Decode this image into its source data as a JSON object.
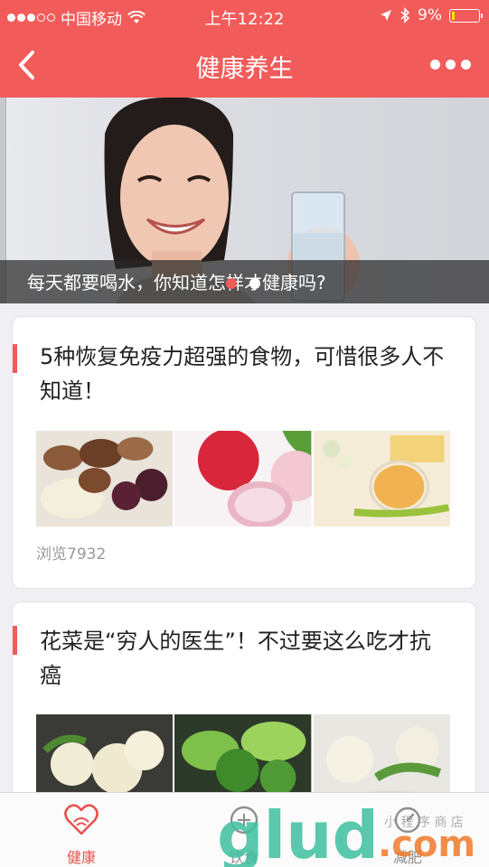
{
  "status_bar": {
    "carrier": "中国移动",
    "time": "上午12:22",
    "battery": "9%",
    "battery_level": 0.09
  },
  "nav": {
    "title": "健康养生"
  },
  "banner": {
    "caption": "每天都要喝水，你知道怎样才健康吗?",
    "active_page": 1,
    "page_count": 2
  },
  "articles": [
    {
      "title": "5种恢复免疫力超强的食物，可惜很多人不知道！",
      "views": "浏览7932"
    },
    {
      "title": "花菜是“穷人的医生”！不过要这么吃才抗癌"
    }
  ],
  "tabs": [
    {
      "label": "健康",
      "active": true
    },
    {
      "label": "饮食",
      "active": false
    },
    {
      "label": "减肥",
      "active": false
    }
  ],
  "watermark": {
    "text": "glud.com",
    "stamp": "小程序商店"
  },
  "colors": {
    "accent": "#f15b5a",
    "tab_active": "#e8524f",
    "tab_inactive": "#8e8e8e"
  }
}
